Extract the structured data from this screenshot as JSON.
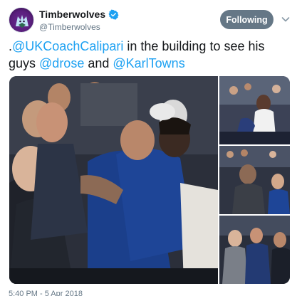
{
  "account": {
    "display_name": "Timberwolves",
    "handle": "@Timberwolves",
    "verified_icon": "verified-badge-icon",
    "avatar_icon": "wolf-logo-icon"
  },
  "follow_button": {
    "label": "Following"
  },
  "tweet": {
    "segments": [
      {
        "text": ".",
        "type": "plain"
      },
      {
        "text": "@UKCoachCalipari",
        "type": "mention"
      },
      {
        "text": " in the building to see his guys ",
        "type": "plain"
      },
      {
        "text": "@drose",
        "type": "mention"
      },
      {
        "text": " and ",
        "type": "plain"
      },
      {
        "text": "@KarlTowns",
        "type": "mention"
      }
    ]
  },
  "media": {
    "photos": [
      {
        "name": "photo-hug"
      },
      {
        "name": "photo-player-courtside"
      },
      {
        "name": "photo-sideline-crowd"
      },
      {
        "name": "photo-coaches-talking"
      }
    ]
  },
  "timestamp": "5:40 PM - 5 Apr 2018",
  "colors": {
    "mention": "#1da1f2",
    "follow_bg": "#657786",
    "verified": "#1da1f2",
    "avatar": "#5a1f7d"
  }
}
